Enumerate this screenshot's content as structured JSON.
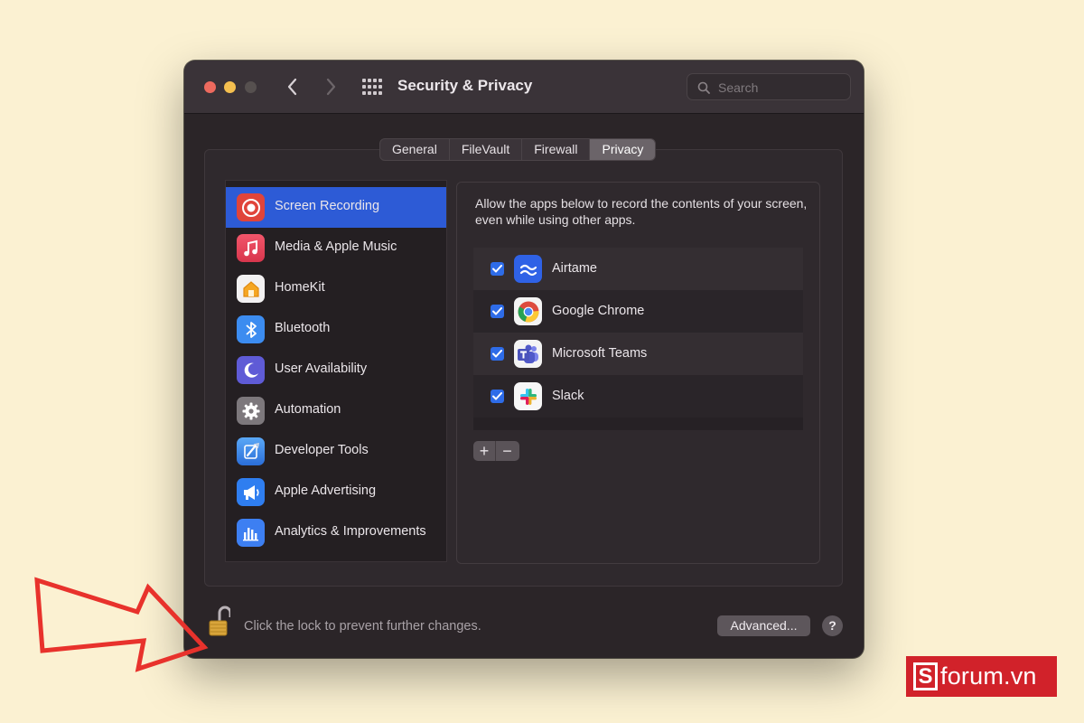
{
  "window": {
    "title": "Security & Privacy",
    "search_placeholder": "Search"
  },
  "tabs": [
    {
      "label": "General",
      "active": false
    },
    {
      "label": "FileVault",
      "active": false
    },
    {
      "label": "Firewall",
      "active": false
    },
    {
      "label": "Privacy",
      "active": true
    }
  ],
  "sidebar": {
    "items": [
      {
        "label": "Screen Recording",
        "icon": "screen-recording-icon",
        "selected": true
      },
      {
        "label": "Media & Apple Music",
        "icon": "music-icon",
        "selected": false
      },
      {
        "label": "HomeKit",
        "icon": "home-icon",
        "selected": false
      },
      {
        "label": "Bluetooth",
        "icon": "bluetooth-icon",
        "selected": false
      },
      {
        "label": "User Availability",
        "icon": "moon-icon",
        "selected": false
      },
      {
        "label": "Automation",
        "icon": "gear-icon",
        "selected": false
      },
      {
        "label": "Developer Tools",
        "icon": "developer-tools-icon",
        "selected": false
      },
      {
        "label": "Apple Advertising",
        "icon": "megaphone-icon",
        "selected": false
      },
      {
        "label": "Analytics & Improvements",
        "icon": "bar-chart-icon",
        "selected": false
      }
    ]
  },
  "panel": {
    "description": "Allow the apps below to record the contents of your screen, even while using other apps.",
    "apps": [
      {
        "name": "Airtame",
        "checked": true,
        "icon": "airtame-icon"
      },
      {
        "name": "Google Chrome",
        "checked": true,
        "icon": "chrome-icon"
      },
      {
        "name": "Microsoft Teams",
        "checked": true,
        "icon": "teams-icon"
      },
      {
        "name": "Slack",
        "checked": true,
        "icon": "slack-icon"
      }
    ],
    "add_label": "+",
    "remove_label": "−"
  },
  "footer": {
    "lock_text": "Click the lock to prevent further changes.",
    "advanced_label": "Advanced...",
    "help_label": "?"
  },
  "watermark": {
    "logo_letter": "S",
    "logo_text": "forum.vn"
  },
  "colors": {
    "background": "#fbf1d2",
    "accent": "#2d5bd6",
    "checkbox": "#2e6ce8",
    "arrow": "#e8322c",
    "brand": "#d1222a"
  }
}
